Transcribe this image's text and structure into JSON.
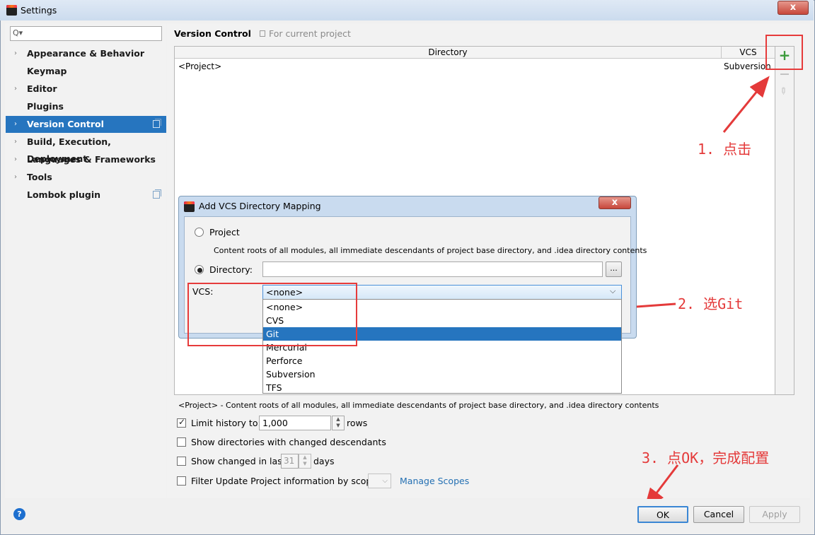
{
  "window": {
    "title": "Settings",
    "close_label": "x"
  },
  "sidebar": {
    "search_placeholder": "Q▾",
    "items": [
      {
        "label": "Appearance & Behavior",
        "arrow": "›"
      },
      {
        "label": "Keymap",
        "arrow": ""
      },
      {
        "label": "Editor",
        "arrow": "›"
      },
      {
        "label": "Plugins",
        "arrow": ""
      },
      {
        "label": "Version Control",
        "arrow": "›"
      },
      {
        "label": "Build, Execution, Deployment",
        "arrow": "›"
      },
      {
        "label": "Languages & Frameworks",
        "arrow": "›"
      },
      {
        "label": "Tools",
        "arrow": "›"
      },
      {
        "label": "Lombok plugin",
        "arrow": ""
      }
    ]
  },
  "main": {
    "title": "Version Control",
    "scope_label": "For current project",
    "table": {
      "col_directory": "Directory",
      "col_vcs": "VCS",
      "row_directory": "<Project>",
      "row_vcs": "Subversion"
    },
    "note": "<Project> - Content roots of all modules, all immediate descendants of project base directory, and .idea directory contents",
    "options": {
      "limit_history_label": "Limit history to:",
      "limit_history_value": "1,000",
      "limit_history_unit": "rows",
      "show_dirs_label": "Show directories with changed descendants",
      "show_changed_label": "Show changed in last",
      "show_changed_value": "31",
      "show_changed_unit": "days",
      "filter_label": "Filter Update Project information by scope",
      "manage_scopes": "Manage Scopes"
    }
  },
  "dialog": {
    "title": "Add VCS Directory Mapping",
    "project_label": "Project",
    "project_desc": "Content roots of all modules, all immediate descendants of project base directory, and .idea directory contents",
    "directory_label": "Directory:",
    "directory_value": "",
    "browse_label": "...",
    "vcs_label": "VCS:",
    "vcs_selected": "<none>",
    "vcs_options": [
      "<none>",
      "CVS",
      "Git",
      "Mercurial",
      "Perforce",
      "Subversion",
      "TFS"
    ]
  },
  "annotations": {
    "step1": "1. 点击",
    "step2": "2. 选Git",
    "step3": "3. 点OK，完成配置"
  },
  "footer": {
    "help": "?",
    "ok": "OK",
    "cancel": "Cancel",
    "apply": "Apply"
  },
  "colors": {
    "selection": "#2675bf",
    "annotation": "#e43a3a",
    "link": "#2470b3"
  }
}
